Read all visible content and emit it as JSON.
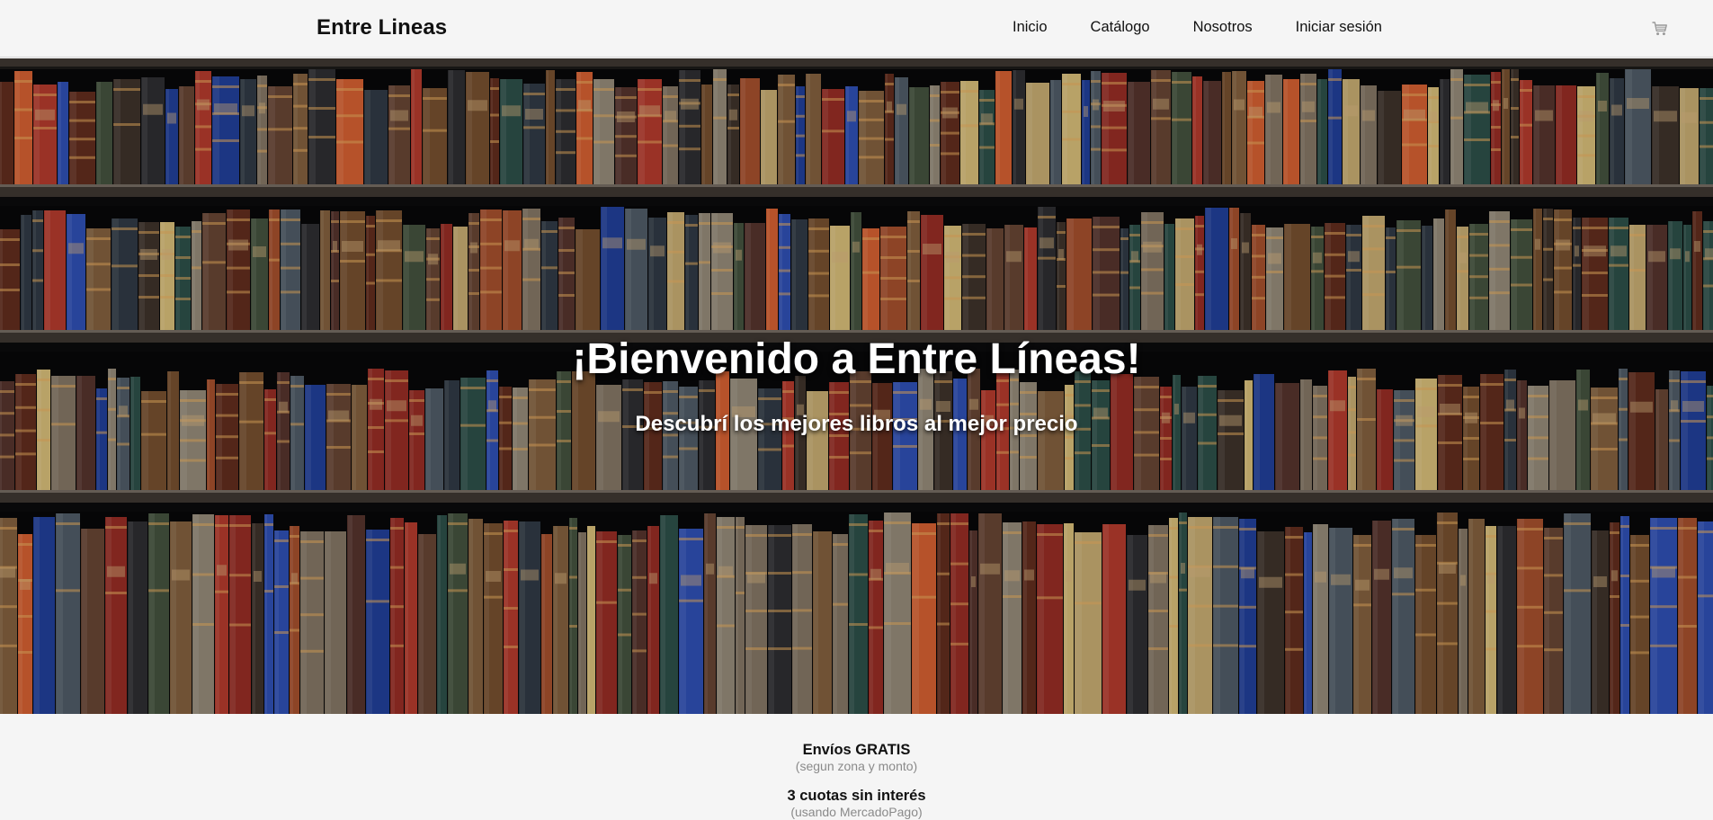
{
  "header": {
    "brand": "Entre Lineas",
    "nav": [
      {
        "label": "Inicio"
      },
      {
        "label": "Catálogo"
      },
      {
        "label": "Nosotros"
      },
      {
        "label": "Iniciar sesión"
      }
    ],
    "cart_icon": "cart-icon"
  },
  "hero": {
    "title": "¡Bienvenido a Entre Líneas!",
    "subtitle": "Descubrí los mejores libros al mejor precio",
    "background": "bookshelf-image"
  },
  "benefits": [
    {
      "title": "Envíos GRATIS",
      "note": "(segun zona y monto)"
    },
    {
      "title": "3 cuotas sin interés",
      "note": "(usando MercadoPago)"
    }
  ],
  "colors": {
    "page_bg": "#f5f5f5",
    "text": "#111111",
    "muted": "#8a8a8a",
    "hero_text": "#ffffff"
  }
}
